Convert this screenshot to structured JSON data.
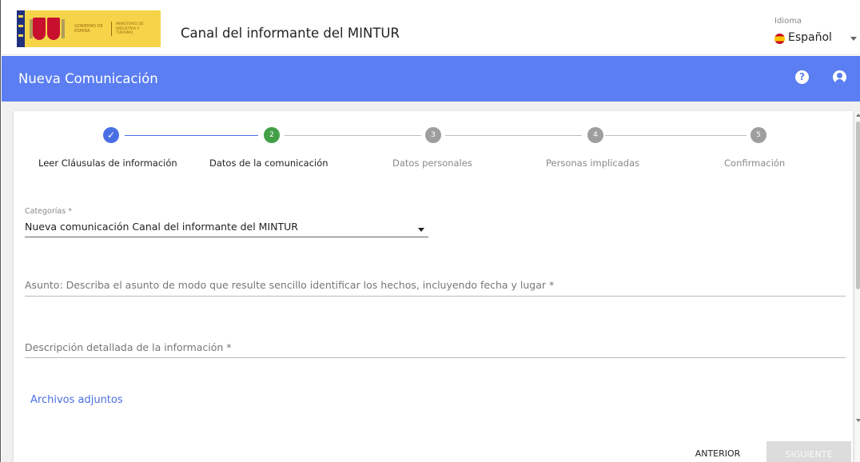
{
  "header": {
    "logo_text_gobierno": "GOBIERNO DE ESPAÑA",
    "logo_text_ministerio": "MINISTERIO DE INDUSTRIA Y TURISMO",
    "app_title": "Canal del informante del MINTUR",
    "language_label": "Idioma",
    "language_value": "Español"
  },
  "bluebar": {
    "page_title": "Nueva Comunicación",
    "help_icon": "?",
    "user_icon": "user-circle"
  },
  "stepper": {
    "steps": [
      {
        "number": "✓",
        "label": "Leer Cláusulas de información",
        "state": "completed"
      },
      {
        "number": "2",
        "label": "Datos de la comunicación",
        "state": "active"
      },
      {
        "number": "3",
        "label": "Datos personales",
        "state": "pending"
      },
      {
        "number": "4",
        "label": "Personas implicadas",
        "state": "pending"
      },
      {
        "number": "5",
        "label": "Confirmación",
        "state": "pending"
      }
    ]
  },
  "form": {
    "category_label": "Categorías *",
    "category_value": "Nueva comunicación Canal del informante del MINTUR",
    "subject_placeholder": "Asunto: Describa el asunto de modo que resulte sencillo identificar los hechos, incluyendo fecha y lugar *",
    "description_placeholder": "Descripción detallada de la información *",
    "attachments_link": "Archivos adjuntos"
  },
  "actions": {
    "previous_label": "ANTERIOR",
    "next_label": "SIGUIENTE"
  },
  "colors": {
    "brand_blue": "#5b7ef2",
    "completed": "#4a6fe3",
    "active": "#43a047",
    "pending": "#9e9e9e"
  }
}
